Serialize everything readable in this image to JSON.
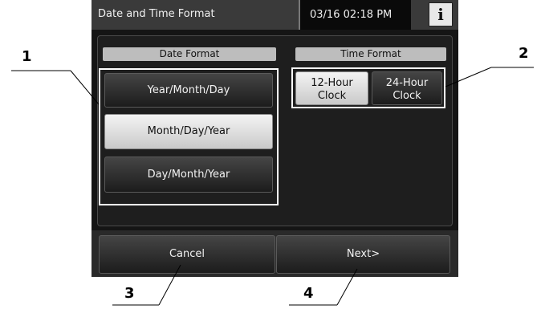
{
  "window": {
    "title": "Date and Time Format",
    "datetime": "03/16 02:18 PM",
    "info_icon": "i"
  },
  "date_format": {
    "label": "Date Format",
    "options": [
      {
        "label": "Year/Month/Day",
        "selected": false
      },
      {
        "label": "Month/Day/Year",
        "selected": true
      },
      {
        "label": "Day/Month/Year",
        "selected": false
      }
    ]
  },
  "time_format": {
    "label": "Time Format",
    "options": [
      {
        "line1": "12-Hour",
        "line2": "Clock",
        "selected": true
      },
      {
        "line1": "24-Hour",
        "line2": "Clock",
        "selected": false
      }
    ]
  },
  "footer": {
    "cancel": "Cancel",
    "next": "Next>"
  },
  "callouts": [
    "1",
    "2",
    "3",
    "4"
  ]
}
